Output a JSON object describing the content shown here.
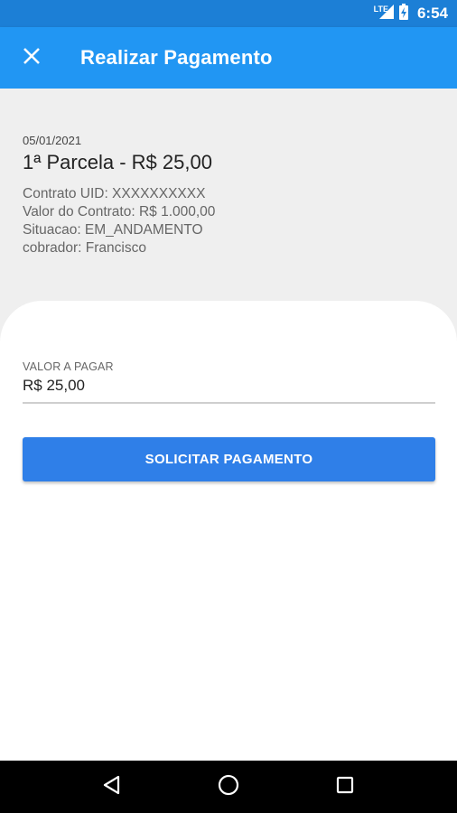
{
  "status_bar": {
    "network": "LTE",
    "time": "6:54"
  },
  "app_bar": {
    "title": "Realizar Pagamento",
    "close_icon": "close-icon"
  },
  "installment": {
    "date": "05/01/2021",
    "title": "1ª Parcela - R$ 25,00",
    "contract_uid": "Contrato UID: XXXXXXXXXX",
    "contract_value": "Valor do Contrato: R$ 1.000,00",
    "status": "Situacao: EM_ANDAMENTO",
    "collector": "cobrador: Francisco"
  },
  "payment_form": {
    "amount_label": "VALOR A PAGAR",
    "amount_value": "R$ 25,00",
    "submit_label": "SOLICITAR PAGAMENTO"
  },
  "colors": {
    "primary": "#2196f3",
    "status_bar": "#1c7fd6",
    "button": "#2f7fe8"
  }
}
